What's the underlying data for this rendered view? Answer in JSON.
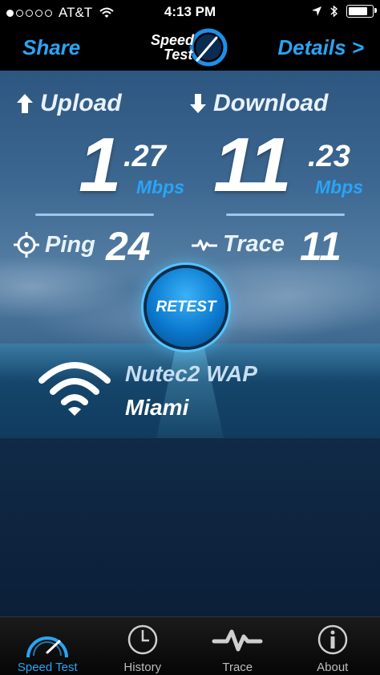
{
  "status_bar": {
    "carrier": "AT&T",
    "time": "4:13 PM",
    "battery_level": 0.9
  },
  "nav": {
    "share_label": "Share",
    "details_label": "Details >",
    "logo_line1": "Speed",
    "logo_line2": "Test"
  },
  "results": {
    "upload_label": "Upload",
    "upload_int": "1",
    "upload_dec": ".27",
    "upload_unit": "Mbps",
    "download_label": "Download",
    "download_int": "11",
    "download_dec": ".23",
    "download_unit": "Mbps",
    "ping_label": "Ping",
    "ping_value": "24",
    "trace_label": "Trace",
    "trace_value": "11",
    "retest_label": "RETEST"
  },
  "network": {
    "name": "Nutec2 WAP",
    "city": "Miami"
  },
  "tabs": [
    {
      "label": "Speed Test",
      "icon": "speedometer-icon",
      "active": true
    },
    {
      "label": "History",
      "icon": "clock-icon",
      "active": false
    },
    {
      "label": "Trace",
      "icon": "trace-wave-icon",
      "active": false
    },
    {
      "label": "About",
      "icon": "info-icon",
      "active": false
    }
  ],
  "colors": {
    "accent": "#2aa4f4"
  }
}
